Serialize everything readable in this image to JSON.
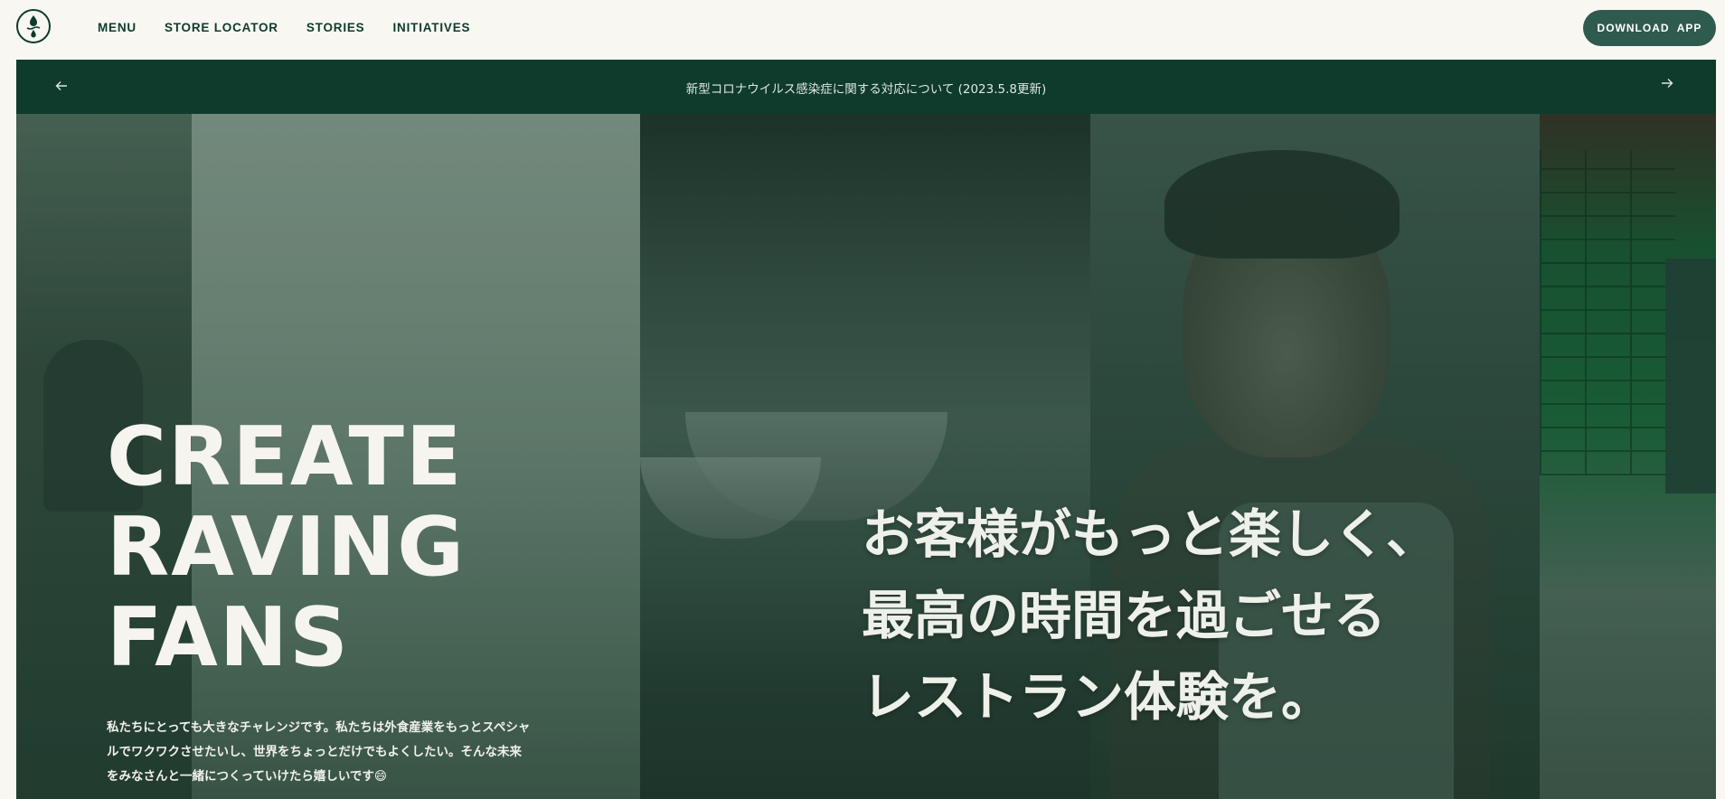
{
  "header": {
    "logo_icon": "drop-logo-icon",
    "nav": [
      {
        "label": "MENU"
      },
      {
        "label": "STORE LOCATOR"
      },
      {
        "label": "STORIES"
      },
      {
        "label": "INITIATIVES"
      }
    ],
    "download_label": "DOWNLOAD  APP"
  },
  "announcement": {
    "text": "新型コロナウイルス感染症に関する対応について (2023.5.8更新)",
    "prev_icon": "arrow-left-icon",
    "next_icon": "arrow-right-icon"
  },
  "hero": {
    "headline": "CREATE\nRAVING\nFANS",
    "body": "私たちにとっても大きなチャレンジです。私たちは外食産業をもっとスペシャルでワクワクさせたいし、世界をちょっとだけでもよくしたい。そんな未来をみなさんと一緒につくっていけたら嬉しいです😄",
    "tagline": "お客様がもっと楽しく、\n最高の時間を過ごせる\nレストラン体験を。"
  },
  "colors": {
    "brand_green": "#0e3b2c",
    "button_green": "#2f5a4e",
    "background": "#f9f7f2"
  }
}
